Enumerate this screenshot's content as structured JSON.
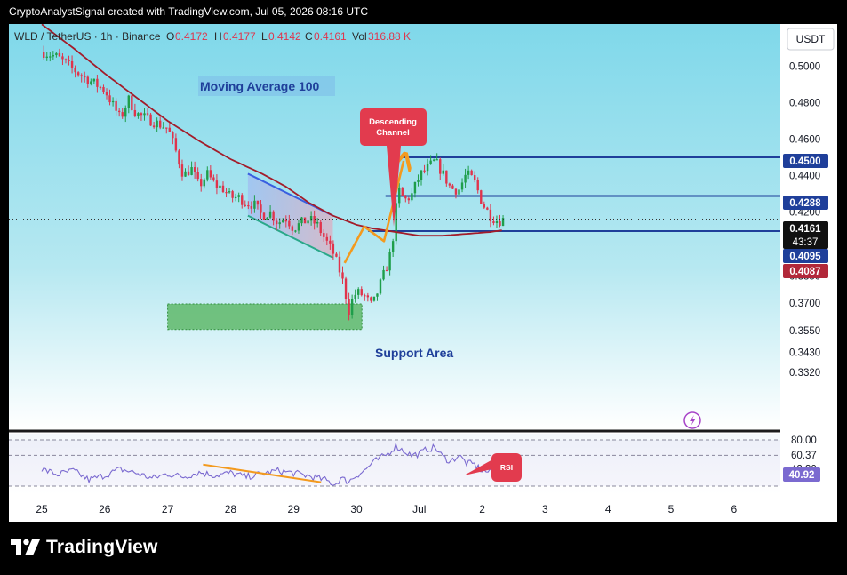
{
  "header": {
    "credit": "CryptoAnalystSignal created with TradingView.com, Jul 05, 2026 08:16 UTC",
    "symbol_line": "WLD / TetherUS · 1h · Binance",
    "o_label": "O",
    "o_value": "0.4172",
    "h_label": "H",
    "h_value": "0.4177",
    "l_label": "L",
    "l_value": "0.4142",
    "c_label": "C",
    "c_value": "0.4161",
    "vol_label": "Vol",
    "vol_value": "316.88 K"
  },
  "currency_button": "USDT",
  "annotations": {
    "ma_label": "Moving Average 100",
    "descending_channel": [
      "Descending",
      "Channel"
    ],
    "support_area": "Support Area",
    "rsi_tag": "RSI"
  },
  "badges": {
    "b4500": "0.4500",
    "b4288": "0.4288",
    "last_price": "0.4161",
    "countdown": "43:37",
    "b4095": "0.4095",
    "ma_value": "0.4087",
    "rsi_value": "40.92"
  },
  "brand": "TradingView",
  "colors": {
    "background_top": "#7fd8ea",
    "background_bottom": "#ffffff",
    "up": "#1e9e4a",
    "down": "#e0344c",
    "ma": "#a31c2a",
    "level": "#1f3f9a",
    "arrow": "#f39a1e",
    "channel_line": "#3a5fe0",
    "channel_lower": "#2aa88a",
    "support_fill": "#5fb86a",
    "rsi_line": "#7b6ad0",
    "badge_red": "#e23b4e"
  },
  "chart_data": [
    {
      "type": "candlestick",
      "symbol": "WLD / TetherUS",
      "interval": "1h",
      "exchange": "Binance",
      "y_axis_ticks": [
        "0.5000",
        "0.4800",
        "0.4600",
        "0.4400",
        "0.4200",
        "0.3850",
        "0.3700",
        "0.3550",
        "0.3430",
        "0.3320"
      ],
      "y_axis_values": [
        0.5,
        0.48,
        0.46,
        0.44,
        0.42,
        0.385,
        0.37,
        0.355,
        0.343,
        0.332
      ],
      "x_axis_ticks": [
        "25",
        "26",
        "27",
        "28",
        "29",
        "30",
        "Jul",
        "2",
        "3",
        "4",
        "5",
        "6"
      ],
      "ohlc_last": {
        "open": 0.4172,
        "high": 0.4177,
        "low": 0.4142,
        "close": 0.4161,
        "volume": "316.88 K"
      },
      "anchor_prices": [
        [
          0,
          0.508
        ],
        [
          2,
          0.505
        ],
        [
          5,
          0.495
        ],
        [
          8,
          0.487
        ],
        [
          10,
          0.471
        ],
        [
          11,
          0.482
        ],
        [
          12,
          0.474
        ],
        [
          14,
          0.47
        ],
        [
          16,
          0.466
        ],
        [
          17,
          0.454
        ],
        [
          18,
          0.44
        ],
        [
          19,
          0.444
        ],
        [
          20,
          0.434
        ],
        [
          21,
          0.441
        ],
        [
          22,
          0.435
        ],
        [
          23,
          0.433
        ],
        [
          24,
          0.428
        ],
        [
          25,
          0.428
        ],
        [
          26,
          0.425
        ],
        [
          27,
          0.424
        ],
        [
          28,
          0.418
        ],
        [
          29,
          0.42
        ],
        [
          30,
          0.414
        ],
        [
          31,
          0.417
        ],
        [
          32,
          0.411
        ],
        [
          33,
          0.414
        ],
        [
          34,
          0.416
        ],
        [
          35,
          0.413
        ],
        [
          36,
          0.405
        ],
        [
          37,
          0.398
        ],
        [
          38,
          0.386
        ],
        [
          38.5,
          0.378
        ],
        [
          39,
          0.365
        ],
        [
          39.5,
          0.372
        ],
        [
          40,
          0.376
        ],
        [
          41,
          0.374
        ],
        [
          42,
          0.368
        ],
        [
          43,
          0.38
        ],
        [
          44,
          0.392
        ],
        [
          44.5,
          0.4
        ],
        [
          45,
          0.421
        ],
        [
          45.5,
          0.433
        ],
        [
          46,
          0.426
        ],
        [
          47,
          0.429
        ],
        [
          48,
          0.44
        ],
        [
          49,
          0.444
        ],
        [
          50,
          0.448
        ],
        [
          51,
          0.441
        ],
        [
          52,
          0.433
        ],
        [
          53,
          0.432
        ],
        [
          54,
          0.441
        ],
        [
          55,
          0.437
        ],
        [
          56,
          0.425
        ],
        [
          57,
          0.418
        ],
        [
          58,
          0.415
        ],
        [
          58.7,
          0.416
        ]
      ],
      "moving_average": {
        "name": "Moving Average 100",
        "length": 100,
        "points": [
          [
            0,
            0.523
          ],
          [
            4,
            0.51
          ],
          [
            8,
            0.496
          ],
          [
            12,
            0.483
          ],
          [
            16,
            0.47
          ],
          [
            20,
            0.459
          ],
          [
            24,
            0.449
          ],
          [
            28,
            0.441
          ],
          [
            31,
            0.434
          ],
          [
            34,
            0.425
          ],
          [
            37,
            0.418
          ],
          [
            40,
            0.413
          ],
          [
            42,
            0.411
          ],
          [
            45,
            0.409
          ],
          [
            48,
            0.407
          ],
          [
            51,
            0.407
          ],
          [
            54,
            0.408
          ],
          [
            57,
            0.409
          ],
          [
            58.7,
            0.41
          ]
        ]
      },
      "levels": [
        {
          "price": 0.45,
          "label": "0.4500",
          "from_day": 45.1
        },
        {
          "price": 0.4288,
          "label": "0.4288",
          "from_day": 43.7
        },
        {
          "price": 0.4095,
          "label": "0.4095",
          "from_day": 41.5
        }
      ],
      "descending_channel": {
        "upper": [
          [
            26.2,
            0.441
          ],
          [
            37.0,
            0.418
          ]
        ],
        "lower": [
          [
            26.2,
            0.418
          ],
          [
            37.0,
            0.395
          ]
        ]
      },
      "support_area": {
        "from_day": 16.0,
        "to_day": 40.7,
        "low": 0.3555,
        "high": 0.3695
      },
      "projection_path": [
        [
          38.5,
          0.392
        ],
        [
          41.0,
          0.412
        ],
        [
          43.5,
          0.404
        ],
        [
          46.0,
          0.448
        ]
      ]
    },
    {
      "type": "line",
      "name": "RSI",
      "y_axis_ticks": [
        "80.00",
        "60.37",
        "42.30",
        "40.92"
      ],
      "y_axis_values": [
        80,
        60.37,
        42.3,
        40.92
      ],
      "bands": [
        80,
        60,
        20
      ],
      "trendline": [
        [
          20.5,
          48
        ],
        [
          35.5,
          25
        ]
      ],
      "anchor_values": [
        [
          0,
          42
        ],
        [
          2,
          35
        ],
        [
          4,
          40
        ],
        [
          6,
          28
        ],
        [
          8,
          34
        ],
        [
          10,
          42
        ],
        [
          12,
          37
        ],
        [
          14,
          30
        ],
        [
          16,
          36
        ],
        [
          18,
          32
        ],
        [
          20,
          38
        ],
        [
          22,
          34
        ],
        [
          24,
          37
        ],
        [
          26,
          32
        ],
        [
          28,
          36
        ],
        [
          30,
          40
        ],
        [
          32,
          37
        ],
        [
          34,
          33
        ],
        [
          36,
          28
        ],
        [
          37.3,
          22
        ],
        [
          38,
          30
        ],
        [
          39,
          26
        ],
        [
          40,
          34
        ],
        [
          41,
          40
        ],
        [
          42,
          50
        ],
        [
          43,
          56
        ],
        [
          44,
          62
        ],
        [
          45,
          72
        ],
        [
          46,
          66
        ],
        [
          47,
          60
        ],
        [
          48,
          62
        ],
        [
          49,
          68
        ],
        [
          50,
          70
        ],
        [
          51,
          58
        ],
        [
          52,
          52
        ],
        [
          53,
          60
        ],
        [
          54,
          50
        ],
        [
          55,
          48
        ],
        [
          56,
          40
        ],
        [
          57,
          38
        ],
        [
          58.7,
          41
        ]
      ]
    }
  ]
}
